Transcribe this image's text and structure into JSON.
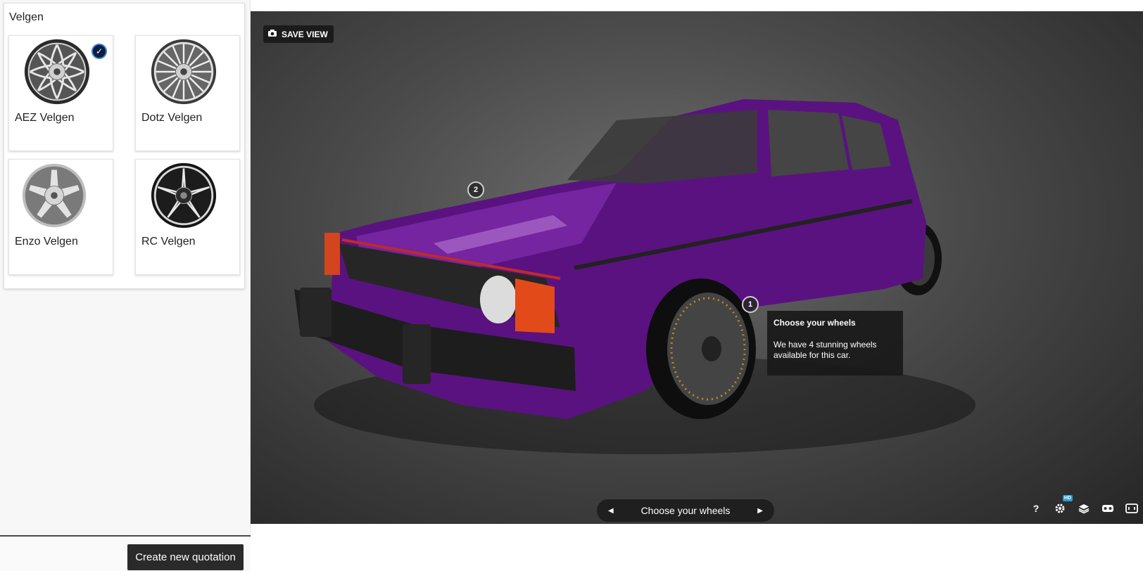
{
  "sidebar": {
    "panel_title": "Velgen",
    "wheels": [
      {
        "label": "AEZ Velgen",
        "selected": true,
        "style": "mesh-silver"
      },
      {
        "label": "Dotz Velgen",
        "selected": false,
        "style": "multispoke-silver"
      },
      {
        "label": "Enzo Velgen",
        "selected": false,
        "style": "5spoke-silver"
      },
      {
        "label": "RC Velgen",
        "selected": false,
        "style": "multispoke-black"
      }
    ],
    "quote_button": "Create new quotation"
  },
  "viewer": {
    "save_view_label": "SAVE VIEW",
    "hotspots": [
      {
        "number": "1"
      },
      {
        "number": "2"
      }
    ],
    "tooltip": {
      "title": "Choose your wheels",
      "body": "We have 4 stunning wheels available for this car."
    },
    "nav": {
      "label": "Choose your wheels"
    },
    "toolbar": {
      "help": "?",
      "hd_badge": "HD"
    },
    "car_color": "#5a1280"
  }
}
